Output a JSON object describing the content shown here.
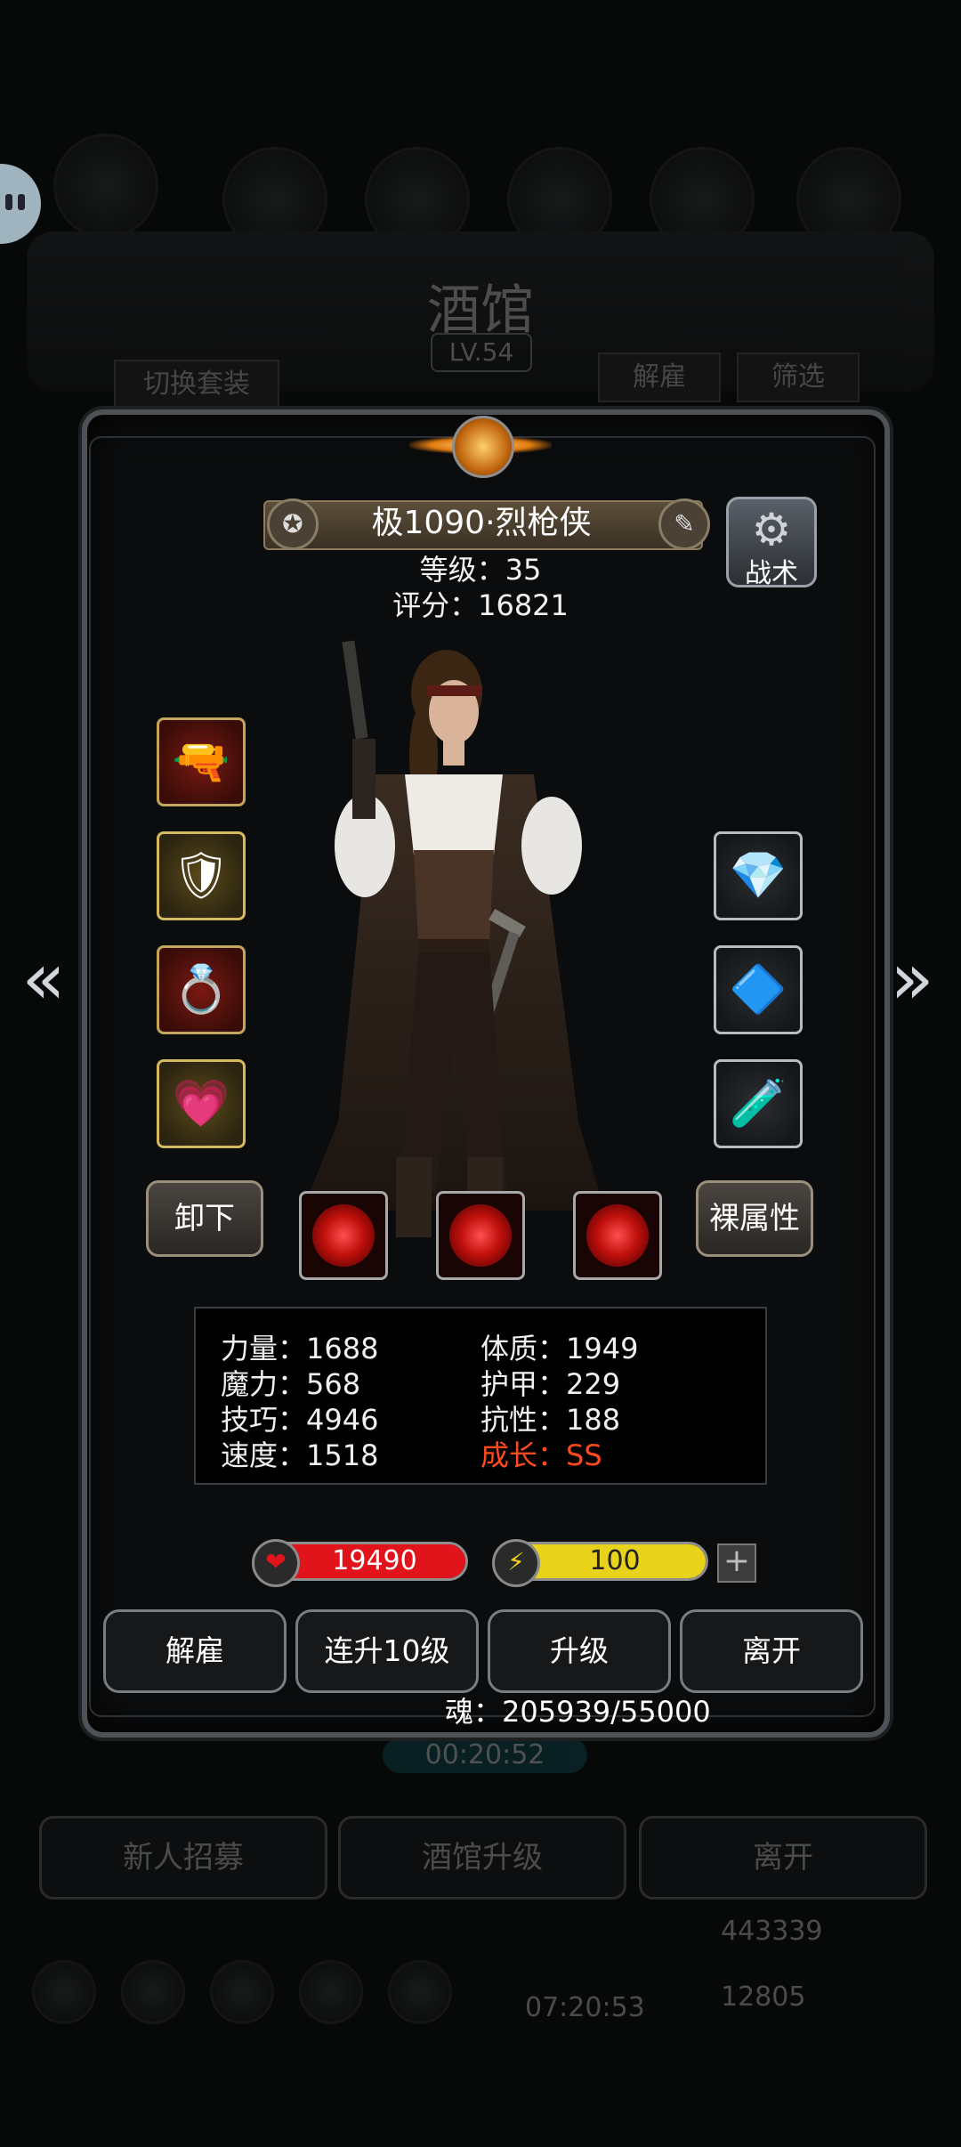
{
  "background": {
    "title": "酒馆",
    "level": "LV.54",
    "switch_outfit": "切换套装",
    "dismiss": "解雇",
    "filter": "筛选",
    "timer": "00:20:52",
    "bottom_buttons": [
      "新人招募",
      "酒馆升级",
      "离开"
    ],
    "bottom_timer": "07:20:53",
    "gold": "443339",
    "gems": "12805"
  },
  "hero": {
    "name": "极1090·烈枪侠",
    "level_label": "等级：35",
    "score_label": "评分：16821",
    "tactic_label": "战术"
  },
  "left_slots": [
    {
      "icon": "flintlock-pistol-icon",
      "glyph": "🔫"
    },
    {
      "icon": "armor-icon",
      "glyph": "🛡"
    },
    {
      "icon": "ring-icon",
      "glyph": "💍"
    },
    {
      "icon": "heart-amulet-icon",
      "glyph": "💗"
    }
  ],
  "right_slots": [
    {
      "icon": "green-crystal-icon",
      "glyph": "💎"
    },
    {
      "icon": "blue-gem-icon",
      "glyph": "🔷"
    },
    {
      "icon": "potion-icon",
      "glyph": "🧪"
    }
  ],
  "buttons": {
    "unequip": "卸下",
    "base_attributes": "裸属性"
  },
  "stats": {
    "strength": "力量：1688",
    "magic": "魔力：568",
    "skill": "技巧：4946",
    "speed": "速度：1518",
    "constitution": "体质：1949",
    "armor": "护甲：229",
    "resistance": "抗性：188",
    "growth": "成长：SS"
  },
  "hp": {
    "value": "19490",
    "fraction": 1.0,
    "color": "#e0141a"
  },
  "energy": {
    "value": "100",
    "fraction": 1.0,
    "color": "#e8d21a"
  },
  "actions": [
    "解雇",
    "连升10级",
    "升级",
    "离开"
  ],
  "soul": "魂：205939/55000"
}
